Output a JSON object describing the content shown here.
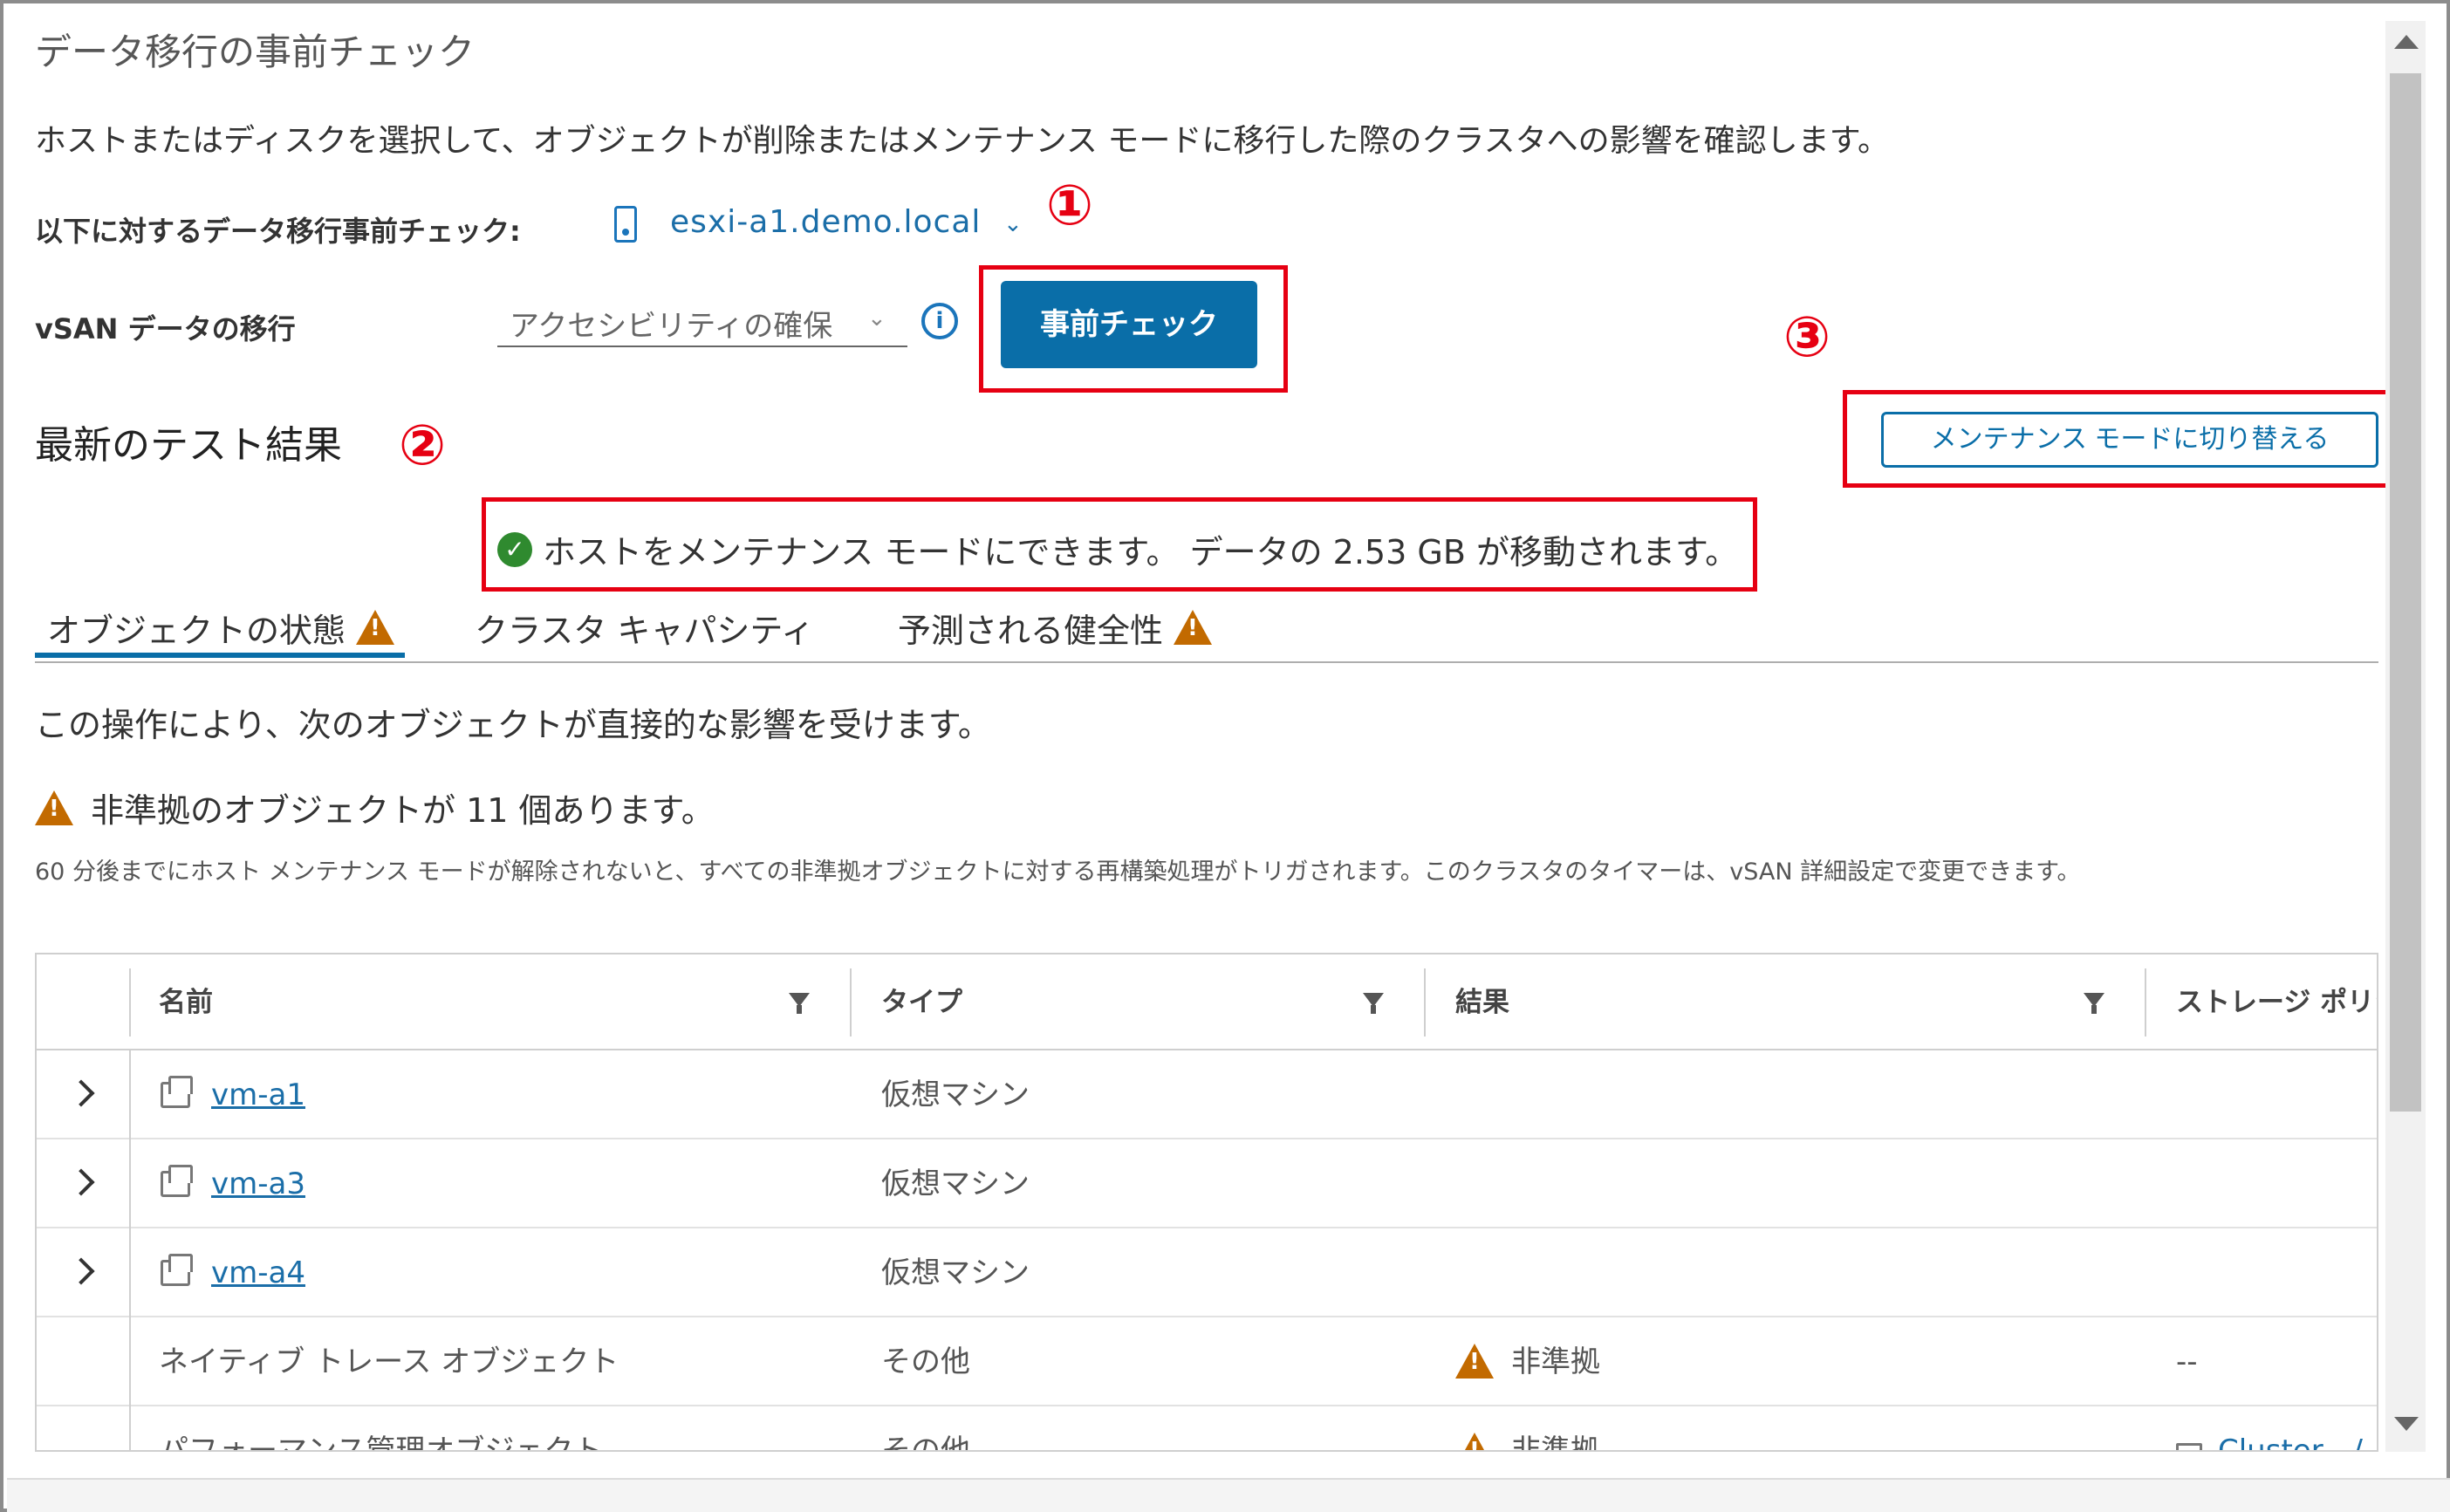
{
  "dialog": {
    "title": "データ移行の事前チェック",
    "description": "ホストまたはディスクを選択して、オブジェクトが削除またはメンテナンス モードに移行した際のクラスタへの影響を確認します。"
  },
  "host_select": {
    "label": "以下に対するデータ移行事前チェック:",
    "value": "esxi-a1.demo.local"
  },
  "vsan_migration": {
    "label": "vSAN データの移行",
    "selected": "アクセシビリティの確保"
  },
  "precheck_button": "事前チェック",
  "annotations": {
    "n1": "①",
    "n2": "②",
    "n3": "③",
    "color": "#e60012"
  },
  "latest_results": {
    "heading": "最新のテスト結果",
    "maintenance_button": "メンテナンス モードに切り替える",
    "message": "ホストをメンテナンス モードにできます。 データの 2.53 GB が移動されます。"
  },
  "tabs": [
    {
      "label": "オブジェクトの状態",
      "warning": true,
      "active": true
    },
    {
      "label": "クラスタ キャパシティ",
      "warning": false,
      "active": false
    },
    {
      "label": "予測される健全性",
      "warning": true,
      "active": false
    }
  ],
  "impact_text": "この操作により、次のオブジェクトが直接的な影響を受けます。",
  "noncompliant_text": "非準拠のオブジェクトが 11 個あります。",
  "timer_text": "60 分後までにホスト メンテナンス モードが解除されないと、すべての非準拠オブジェクトに対する再構築処理がトリガされます。このクラスタのタイマーは、vSAN 詳細設定で変更できます。",
  "table": {
    "columns": [
      "名前",
      "タイプ",
      "結果",
      "ストレージ ポリシ"
    ],
    "rows": [
      {
        "name": "vm-a1",
        "type": "仮想マシン",
        "result": "",
        "policy": "",
        "expandable": true,
        "vm": true
      },
      {
        "name": "vm-a3",
        "type": "仮想マシン",
        "result": "",
        "policy": "",
        "expandable": true,
        "vm": true
      },
      {
        "name": "vm-a4",
        "type": "仮想マシン",
        "result": "",
        "policy": "",
        "expandable": true,
        "vm": true
      },
      {
        "name": "ネイティブ トレース オブジェクト",
        "type": "その他",
        "result": "非準拠",
        "policy": "--",
        "expandable": false,
        "vm": false
      },
      {
        "name": "パフォーマンス管理オブジェクト",
        "type": "その他",
        "result": "非準拠",
        "policy": "Cluster - /",
        "expandable": false,
        "vm": false
      }
    ]
  },
  "colors": {
    "primary": "#0a6ea8",
    "link": "#1b6ea8",
    "success": "#2f8a2f",
    "warning": "#c26a00"
  }
}
